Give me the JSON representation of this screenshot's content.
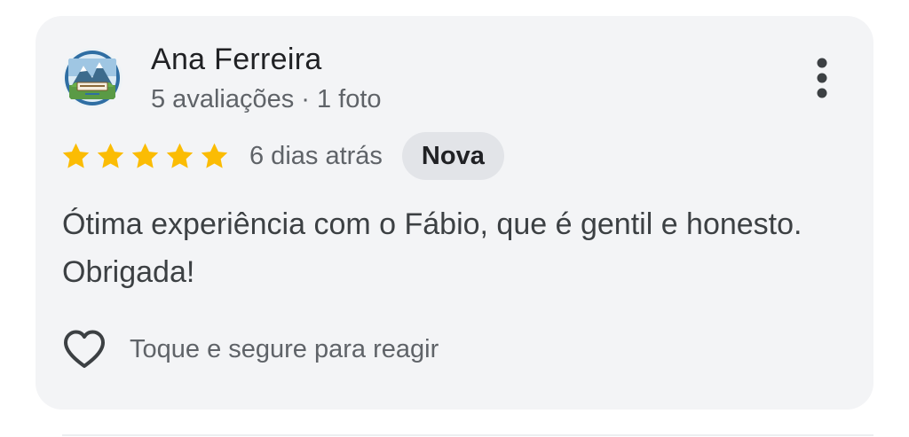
{
  "review": {
    "author_name": "Ana Ferreira",
    "author_meta": "5 avaliações · 1 foto",
    "avatar_icon": "profile-avatar-icon",
    "rating": 5,
    "rating_max": 5,
    "time_ago": "6 dias atrás",
    "badge": "Nova",
    "text": "Ótima experiência com o Fábio, que é gentil e honesto. Obrigada!",
    "more_icon": "more-vert-icon",
    "react_icon": "heart-outline-icon",
    "react_hint": "Toque e segure para reagir"
  },
  "colors": {
    "card_background": "#f3f4f6",
    "star": "#fbbc04",
    "badge_background": "#e2e4e8",
    "primary_text": "#202124",
    "secondary_text": "#5f6368"
  }
}
